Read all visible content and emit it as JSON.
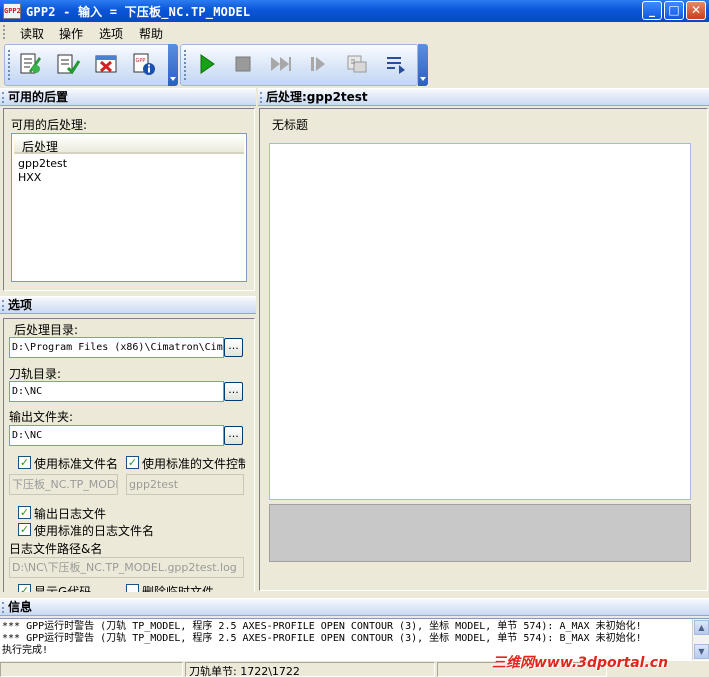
{
  "window": {
    "title": "GPP2 - 输入 = 下压板_NC.TP_MODEL",
    "app_icon_text": "GPP2"
  },
  "menu": [
    {
      "label": "读取"
    },
    {
      "label": "操作"
    },
    {
      "label": "选项"
    },
    {
      "label": "帮助"
    }
  ],
  "toolbar1": [
    {
      "icon": "load-postprocessor-icon"
    },
    {
      "icon": "check-list-icon"
    },
    {
      "icon": "delete-icon"
    },
    {
      "icon": "gpp-info-icon"
    }
  ],
  "toolbar2": [
    {
      "icon": "play-icon"
    },
    {
      "icon": "stop-icon"
    },
    {
      "icon": "fast-forward-icon"
    },
    {
      "icon": "step-icon"
    },
    {
      "icon": "output-window-icon"
    },
    {
      "icon": "list-arrow-icon"
    }
  ],
  "available_panel": {
    "header": "可用的后置",
    "label": "可用的后处理:",
    "column": "后处理",
    "items": [
      "gpp2test",
      "HXX"
    ]
  },
  "post_panel": {
    "header": "后处理:gpp2test",
    "untitled": "无标题"
  },
  "options_panel": {
    "header": "选项",
    "post_dir_label": "后处理目录:",
    "post_dir_value": "D:\\Program Files (x86)\\Cimatron\\Cimatro",
    "toolpath_dir_label": "刀轨目录:",
    "toolpath_dir_value": "D:\\NC",
    "output_dir_label": "输出文件夹:",
    "output_dir_value": "D:\\NC",
    "browse_label": "...",
    "use_std_filename": "使用标准文件名",
    "use_std_file_control": "使用标准的文件控制",
    "std_filename_value": "下压板_NC.TP_MODEL",
    "file_control_value": "gpp2test",
    "output_log": "输出日志文件",
    "use_std_log_name": "使用标准的日志文件名",
    "log_path_label": "日志文件路径&名",
    "log_path_value": "D:\\NC\\下压板_NC.TP_MODEL.gpp2test.log",
    "show_gcode": "显示G代码",
    "delete_temp": "删除临时文件"
  },
  "info_panel": {
    "header": "信息",
    "messages": [
      "*** GPP运行时警告 (刀轨 TP_MODEL, 程序 2.5 AXES-PROFILE OPEN CONTOUR (3), 坐标 MODEL, 单节 574): A_MAX 未初始化!",
      "*** GPP运行时警告 (刀轨 TP_MODEL, 程序 2.5 AXES-PROFILE OPEN CONTOUR (3), 坐标 MODEL, 单节 574): B_MAX 未初始化!",
      "执行完成!"
    ]
  },
  "status_bar": {
    "block_text": "刀轨单节: 1722\\1722"
  },
  "watermark": "三维网www.3dportal.cn",
  "colors": {
    "title_bar": "#0a56d8",
    "accent_green": "#21a121",
    "panel_bg": "#ece9d8"
  }
}
